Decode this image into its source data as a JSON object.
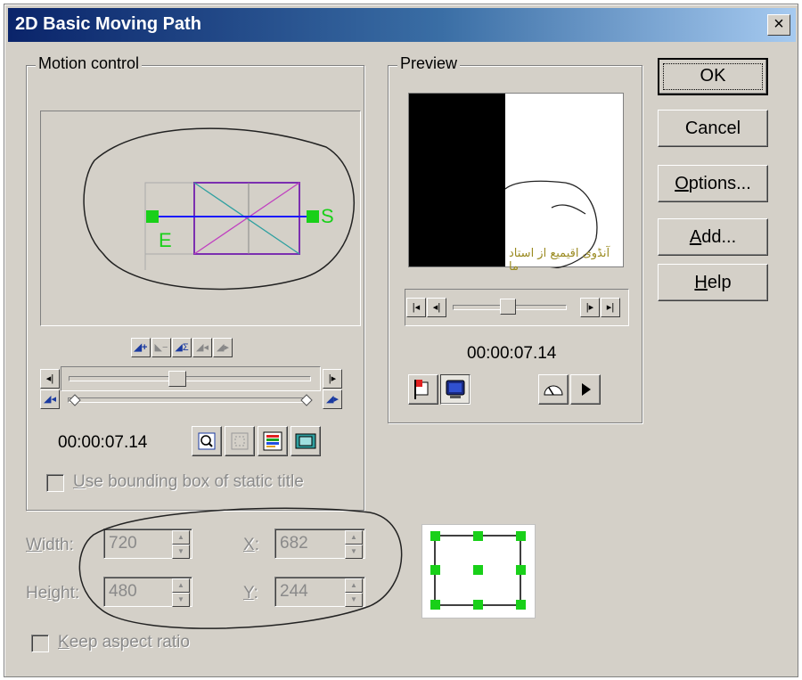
{
  "window": {
    "title": "2D Basic Moving Path",
    "close_glyph": "×"
  },
  "buttons": {
    "ok": "OK",
    "cancel": "Cancel",
    "options": {
      "accel": "O",
      "rest": "ptions..."
    },
    "add": {
      "accel": "A",
      "rest": "dd..."
    },
    "help": {
      "accel": "H",
      "rest": "elp"
    }
  },
  "motion_control": {
    "label": "Motion control",
    "start_marker": "S",
    "end_marker": "E",
    "timecode": "00:00:07.14",
    "path_color": "#7b2fb0",
    "marker_color": "#19d019",
    "line_color": "#1a1aff"
  },
  "preview": {
    "label": "Preview",
    "timecode": "00:00:07.14",
    "text_overlay": "آنڈوی اقیمیع از استاد ما"
  },
  "bounding_box": {
    "label_accel": "U",
    "label_rest": "se bounding box of static title",
    "checked": false
  },
  "size": {
    "width_label_accel": "W",
    "width_label_rest": "idth:",
    "width_value": "720",
    "height_label_pre": "He",
    "height_label_accel": "i",
    "height_label_rest": "ght:",
    "height_value": "480",
    "x_label_accel": "X",
    "x_label_rest": ":",
    "x_value": "682",
    "y_label_accel": "Y",
    "y_label_rest": ":",
    "y_value": "244"
  },
  "aspect": {
    "label_accel": "K",
    "label_rest": "eep aspect ratio",
    "checked": false
  },
  "colors": {
    "face": "#d4d0c8",
    "title_start": "#0a246a",
    "title_end": "#a6caf0",
    "handle_green": "#19d019"
  }
}
